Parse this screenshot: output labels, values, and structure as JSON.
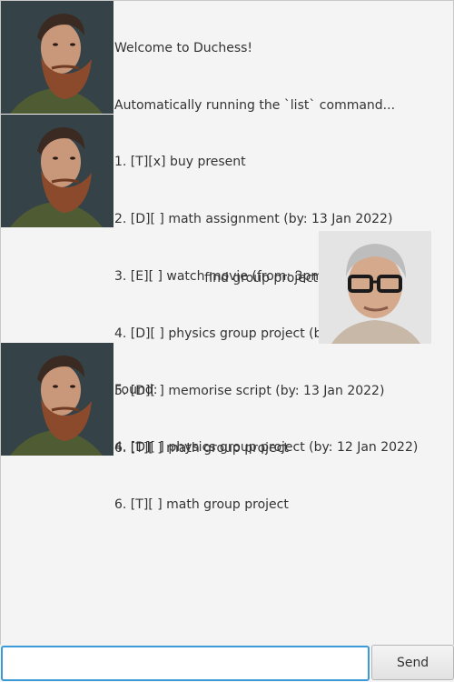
{
  "dialog": [
    {
      "speaker": "duchess",
      "avatar": "bearded-man-avatar",
      "lines": [
        "Welcome to Duchess!",
        "Automatically running the `list` command..."
      ]
    },
    {
      "speaker": "duchess",
      "avatar": "bearded-man-avatar",
      "lines": [
        "1. [T][x] buy present",
        "2. [D][ ] math assignment (by: 13 Jan 2022)",
        "3. [E][ ] watch movie (from: 3pm to: 5pm)",
        "4. [D][ ] physics group project (by: 12 Jan 2022)",
        "5. [D][ ] memorise script (by: 13 Jan 2022)",
        "6. [T][ ] math group project"
      ]
    },
    {
      "speaker": "user",
      "avatar": "older-man-glasses-avatar",
      "lines": [
        "find group project"
      ]
    },
    {
      "speaker": "duchess",
      "avatar": "bearded-man-avatar",
      "lines": [
        "Found:",
        "4. [D][ ] physics group project (by: 12 Jan 2022)",
        "6. [T][ ] math group project"
      ]
    }
  ],
  "input": {
    "value": "",
    "placeholder": ""
  },
  "send_button": {
    "label": "Send"
  },
  "colors": {
    "background": "#f4f4f4",
    "input_focus_border": "#3d9ad9",
    "text": "#333333"
  }
}
